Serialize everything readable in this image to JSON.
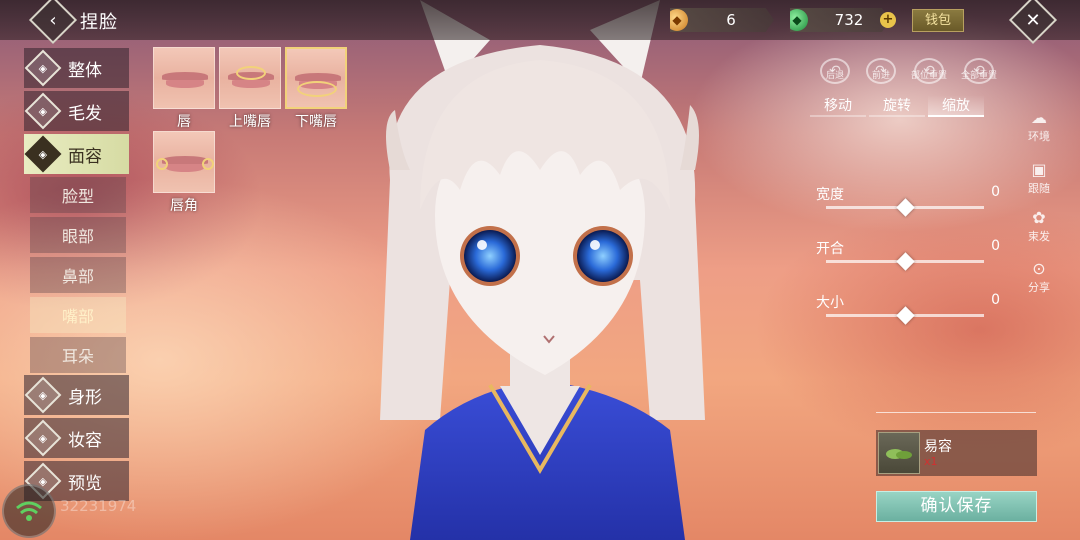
{
  "header": {
    "title": "捏脸",
    "currency_gold": "6",
    "currency_jade": "732",
    "wallet_label": "钱包",
    "plus_label": "+"
  },
  "menu": {
    "main": [
      {
        "label": "整体",
        "icon": "body-outline-icon"
      },
      {
        "label": "毛发",
        "icon": "hair-icon"
      },
      {
        "label": "面容",
        "icon": "face-icon",
        "active": true
      }
    ],
    "sub": [
      {
        "label": "脸型"
      },
      {
        "label": "眼部"
      },
      {
        "label": "鼻部"
      },
      {
        "label": "嘴部",
        "active": true
      },
      {
        "label": "耳朵"
      }
    ],
    "main_bottom": [
      {
        "label": "身形",
        "icon": "figure-icon"
      },
      {
        "label": "妆容",
        "icon": "makeup-icon"
      },
      {
        "label": "预览",
        "icon": "preview-icon"
      }
    ]
  },
  "presets": [
    {
      "label": "唇"
    },
    {
      "label": "上嘴唇"
    },
    {
      "label": "下嘴唇",
      "selected": true
    },
    {
      "label": "唇角"
    }
  ],
  "controls": {
    "undo": "后退",
    "redo": "前进",
    "reset_part": "部位重置",
    "reset_all": "全部重置",
    "tabs": [
      "移动",
      "旋转",
      "缩放"
    ],
    "active_tab": "缩放"
  },
  "sliders": [
    {
      "label": "宽度",
      "value": "0",
      "position": 0.5
    },
    {
      "label": "开合",
      "value": "0",
      "position": 0.5
    },
    {
      "label": "大小",
      "value": "0",
      "position": 0.5
    }
  ],
  "side_tools": [
    "环境",
    "跟随",
    "束发",
    "分享"
  ],
  "item": {
    "name": "易容",
    "count": "x1"
  },
  "save_label": "确认保存",
  "user_id": "32231974",
  "colors": {
    "accent_gold": "#f2d27a",
    "save_button": "#7fc0b0",
    "active_menu": "#e3e7b8"
  }
}
